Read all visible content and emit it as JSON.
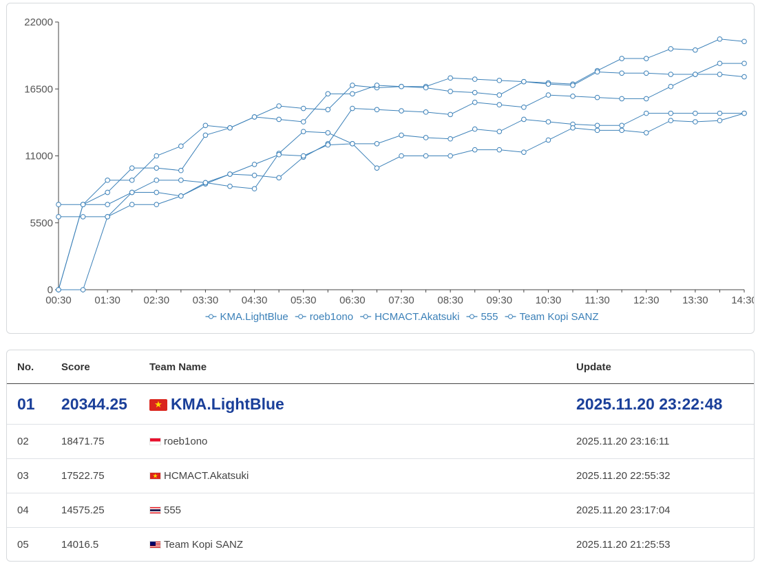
{
  "chart_data": {
    "type": "line",
    "x": [
      "00:30",
      "01:00",
      "01:30",
      "02:00",
      "02:30",
      "03:00",
      "03:30",
      "04:00",
      "04:30",
      "05:00",
      "05:30",
      "06:00",
      "06:30",
      "07:00",
      "07:30",
      "08:00",
      "08:30",
      "09:00",
      "09:30",
      "10:00",
      "10:30",
      "11:00",
      "11:30",
      "12:00",
      "12:30",
      "13:00",
      "13:30",
      "14:00",
      "14:30"
    ],
    "xticks": [
      "00:30",
      "01:30",
      "02:30",
      "03:30",
      "04:30",
      "05:30",
      "06:30",
      "07:30",
      "08:30",
      "09:30",
      "10:30",
      "11:30",
      "12:30",
      "13:30",
      "14:30"
    ],
    "yticks": [
      "0",
      "5500",
      "11000",
      "16500",
      "22000"
    ],
    "ylim": [
      0,
      22000
    ],
    "color": "#3b80b8",
    "legend_position": "bottom",
    "series": [
      {
        "name": "KMA.LightBlue",
        "values": [
          0,
          7000,
          9000,
          9000,
          11000,
          11800,
          13500,
          13300,
          14200,
          15100,
          14900,
          14800,
          16800,
          16600,
          16700,
          16700,
          17400,
          17300,
          17200,
          17100,
          17000,
          16900,
          18000,
          19000,
          19000,
          19800,
          19700,
          20600,
          20400
        ]
      },
      {
        "name": "roeb1ono",
        "values": [
          0,
          7000,
          8000,
          10000,
          10000,
          9800,
          12700,
          13300,
          14200,
          14000,
          13800,
          16100,
          16100,
          16800,
          16700,
          16600,
          16300,
          16200,
          16000,
          17100,
          16900,
          16800,
          17900,
          17800,
          17800,
          17700,
          17700,
          18600,
          18600
        ]
      },
      {
        "name": "HCMACT.Akatsuki",
        "values": [
          7000,
          7000,
          7000,
          8000,
          8000,
          7700,
          8700,
          9500,
          9400,
          9200,
          10900,
          12000,
          14900,
          14800,
          14700,
          14600,
          14400,
          15400,
          15200,
          15000,
          16000,
          15900,
          15800,
          15700,
          15700,
          16700,
          17700,
          17700,
          17500
        ]
      },
      {
        "name": "555",
        "values": [
          6000,
          6000,
          6000,
          8000,
          9000,
          9000,
          8800,
          8500,
          8300,
          11200,
          13000,
          12900,
          12000,
          12000,
          12700,
          12500,
          12400,
          13200,
          13000,
          14000,
          13800,
          13600,
          13500,
          13500,
          14500,
          14500,
          14500,
          14500,
          14500
        ]
      },
      {
        "name": "Team Kopi SANZ",
        "values": [
          0,
          0,
          6000,
          7000,
          7000,
          7700,
          8800,
          9500,
          10300,
          11100,
          11000,
          11900,
          12000,
          10000,
          11000,
          11000,
          11000,
          11500,
          11500,
          11300,
          12300,
          13300,
          13100,
          13100,
          12900,
          13900,
          13800,
          13900,
          14500
        ]
      }
    ]
  },
  "table": {
    "headers": {
      "no": "No.",
      "score": "Score",
      "team": "Team Name",
      "update": "Update"
    },
    "rows": [
      {
        "no": "01",
        "score": "20344.25",
        "flag": "vietnam",
        "team": "KMA.LightBlue",
        "update": "2025.11.20 23:22:48"
      },
      {
        "no": "02",
        "score": "18471.75",
        "flag": "indonesia",
        "team": "roeb1ono",
        "update": "2025.11.20 23:16:11"
      },
      {
        "no": "03",
        "score": "17522.75",
        "flag": "vietnam",
        "team": "HCMACT.Akatsuki",
        "update": "2025.11.20 22:55:32"
      },
      {
        "no": "04",
        "score": "14575.25",
        "flag": "thailand",
        "team": "555",
        "update": "2025.11.20 23:17:04"
      },
      {
        "no": "05",
        "score": "14016.5",
        "flag": "malaysia",
        "team": "Team Kopi SANZ",
        "update": "2025.11.20 21:25:53"
      }
    ]
  }
}
